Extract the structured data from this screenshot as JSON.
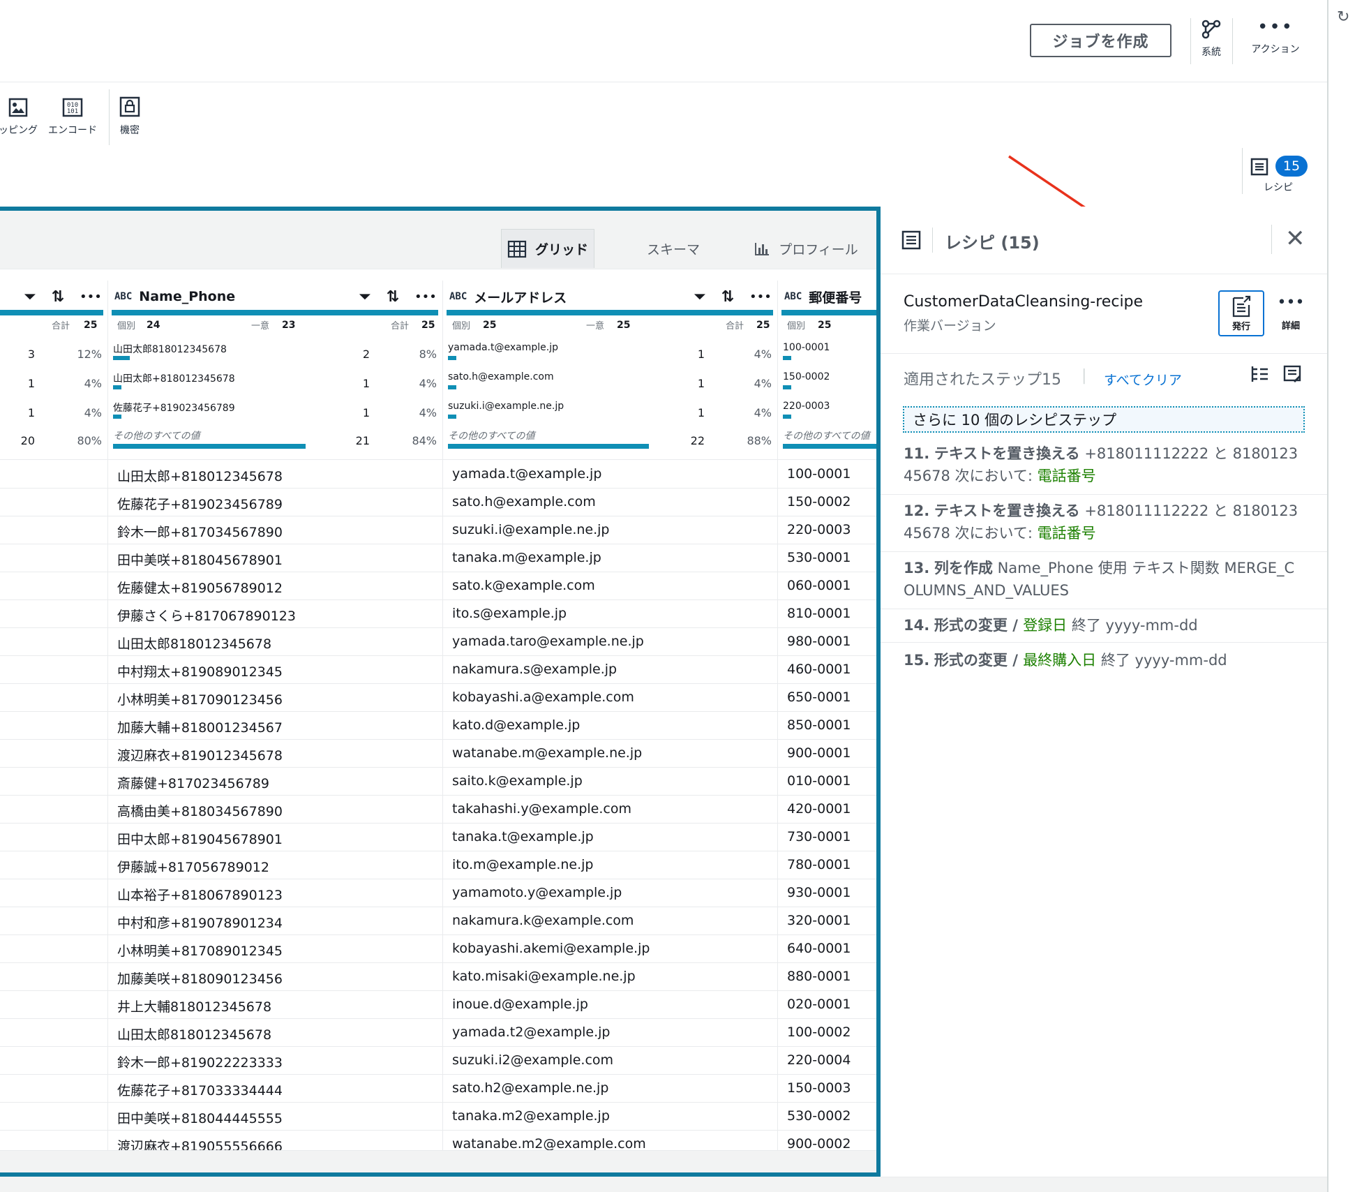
{
  "topbar": {
    "create_job": "ジョブを作成",
    "lineage": "系統",
    "actions": "アクション"
  },
  "toolbar": {
    "mapping": "ッピング",
    "encode": "エンコード",
    "secret": "機密"
  },
  "recipe_toggle": {
    "count": "15",
    "label": "レシピ"
  },
  "view_tabs": {
    "grid": "グリッド",
    "schema": "スキーマ",
    "profile": "プロフィール"
  },
  "columns": [
    {
      "name": "",
      "stats": {
        "total_label": "合計",
        "total": "25"
      },
      "bars": [
        {
          "count": "3",
          "pct": "12%"
        },
        {
          "count": "1",
          "pct": "4%"
        },
        {
          "count": "1",
          "pct": "4%"
        },
        {
          "count": "20",
          "pct": "80%"
        }
      ]
    },
    {
      "name": "Name_Phone",
      "type": "ABC",
      "stats": {
        "distinct_label": "個別",
        "distinct": "24",
        "unique_label": "一意",
        "unique": "23",
        "total_label": "合計",
        "total": "25"
      },
      "bars": [
        {
          "value": "山田太郎818012345678",
          "count": "2",
          "pct": "8%"
        },
        {
          "value": "山田太郎+818012345678",
          "count": "1",
          "pct": "4%"
        },
        {
          "value": "佐藤花子+819023456789",
          "count": "1",
          "pct": "4%"
        },
        {
          "value": "その他のすべての値",
          "count": "21",
          "pct": "84%"
        }
      ]
    },
    {
      "name": "メールアドレス",
      "type": "ABC",
      "stats": {
        "distinct_label": "個別",
        "distinct": "25",
        "unique_label": "一意",
        "unique": "25",
        "total_label": "合計",
        "total": "25"
      },
      "bars": [
        {
          "value": "yamada.t@example.jp",
          "count": "1",
          "pct": "4%"
        },
        {
          "value": "sato.h@example.com",
          "count": "1",
          "pct": "4%"
        },
        {
          "value": "suzuki.i@example.ne.jp",
          "count": "1",
          "pct": "4%"
        },
        {
          "value": "その他のすべての値",
          "count": "22",
          "pct": "88%"
        }
      ]
    },
    {
      "name": "郵便番号",
      "type": "ABC",
      "stats": {
        "distinct_label": "個別",
        "distinct": "25"
      },
      "bars": [
        {
          "value": "100-0001"
        },
        {
          "value": "150-0002"
        },
        {
          "value": "220-0003"
        },
        {
          "value": "その他のすべての値"
        }
      ]
    }
  ],
  "rows": [
    [
      "山田太郎+818012345678",
      "yamada.t@example.jp",
      "100-0001"
    ],
    [
      "佐藤花子+819023456789",
      "sato.h@example.com",
      "150-0002"
    ],
    [
      "鈴木一郎+817034567890",
      "suzuki.i@example.ne.jp",
      "220-0003"
    ],
    [
      "田中美咲+818045678901",
      "tanaka.m@example.jp",
      "530-0001"
    ],
    [
      "佐藤健太+819056789012",
      "sato.k@example.com",
      "060-0001"
    ],
    [
      "伊藤さくら+817067890123",
      "ito.s@example.jp",
      "810-0001"
    ],
    [
      "山田太郎818012345678",
      "yamada.taro@example.ne.jp",
      "980-0001"
    ],
    [
      "中村翔太+819089012345",
      "nakamura.s@example.jp",
      "460-0001"
    ],
    [
      "小林明美+817090123456",
      "kobayashi.a@example.com",
      "650-0001"
    ],
    [
      "加藤大輔+818001234567",
      "kato.d@example.jp",
      "850-0001"
    ],
    [
      "渡辺麻衣+819012345678",
      "watanabe.m@example.ne.jp",
      "900-0001"
    ],
    [
      "斎藤健+817023456789",
      "saito.k@example.jp",
      "010-0001"
    ],
    [
      "高橋由美+818034567890",
      "takahashi.y@example.com",
      "420-0001"
    ],
    [
      "田中太郎+819045678901",
      "tanaka.t@example.jp",
      "730-0001"
    ],
    [
      "伊藤誠+817056789012",
      "ito.m@example.ne.jp",
      "780-0001"
    ],
    [
      "山本裕子+818067890123",
      "yamamoto.y@example.jp",
      "930-0001"
    ],
    [
      "中村和彦+819078901234",
      "nakamura.k@example.com",
      "320-0001"
    ],
    [
      "小林明美+817089012345",
      "kobayashi.akemi@example.jp",
      "640-0001"
    ],
    [
      "加藤美咲+818090123456",
      "kato.misaki@example.ne.jp",
      "880-0001"
    ],
    [
      "井上大輔818012345678",
      "inoue.d@example.jp",
      "020-0001"
    ],
    [
      "山田太郎818012345678",
      "yamada.t2@example.jp",
      "100-0002"
    ],
    [
      "鈴木一郎+819022223333",
      "suzuki.i2@example.com",
      "220-0004"
    ],
    [
      "佐藤花子+817033334444",
      "sato.h2@example.ne.jp",
      "150-0003"
    ],
    [
      "田中美咲+818044445555",
      "tanaka.m2@example.jp",
      "530-0002"
    ],
    [
      "渡辺麻衣+819055556666",
      "watanabe.m2@example.com",
      "900-0002"
    ]
  ],
  "recipe_panel": {
    "title": "レシピ (15)",
    "recipe_name": "CustomerDataCleansing-recipe",
    "version": "作業バージョン",
    "publish": "発行",
    "details": "詳細",
    "applied_steps": "適用されたステップ15",
    "clear_all": "すべてクリア",
    "more_steps": "さらに 10 個のレシピステップ",
    "steps": [
      {
        "num": "11.",
        "action": "テキストを置き換える",
        "line1": " +818011112222 と 8180123",
        "line2a": "45678 次において: ",
        "line2b": "電話番号"
      },
      {
        "num": "12.",
        "action": "テキストを置き換える",
        "line1": " +818011112222 と 8180123",
        "line2a": "45678 次において: ",
        "line2b": "電話番号"
      },
      {
        "num": "13.",
        "action": "列を作成",
        "line1": " Name_Phone 使用 テキスト関数 MERGE_C",
        "line2a": "OLUMNS_AND_VALUES",
        "line2b": ""
      },
      {
        "num": "14.",
        "action": "形式の変更",
        "sep": " / ",
        "col": "登録日",
        "rest": " 終了 yyyy-mm-dd"
      },
      {
        "num": "15.",
        "action": "形式の変更",
        "sep": " / ",
        "col": "最終購入日",
        "rest": " 終了 yyyy-mm-dd"
      }
    ]
  },
  "colors": {
    "accent": "#0f7a9e",
    "bar": "#0f8fb5",
    "badge": "#0972d3",
    "green": "#1d8102",
    "arrow": "#e8321c"
  }
}
